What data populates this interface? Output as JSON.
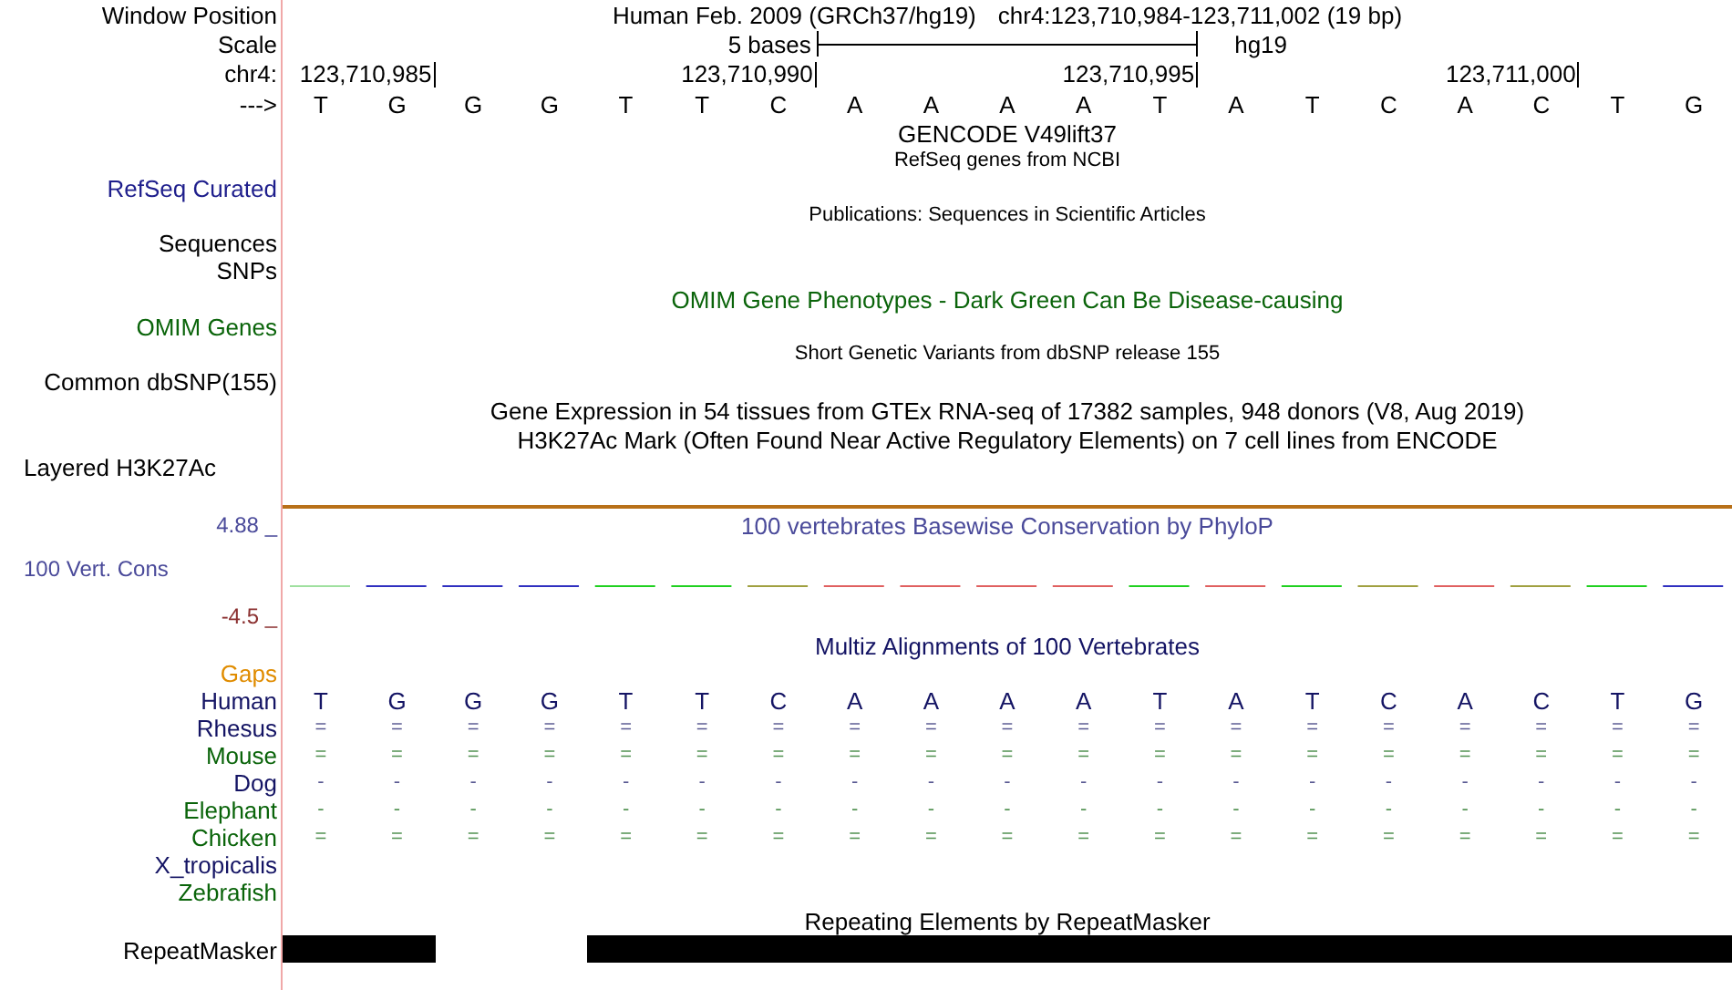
{
  "header": {
    "window_position_label": "Window Position",
    "assembly": "Human Feb. 2009 (GRCh37/hg19)",
    "position": "chr4:123,710,984-123,711,002 (19 bp)"
  },
  "scale": {
    "label": "Scale",
    "span": "5 bases",
    "db": "hg19"
  },
  "ruler": {
    "label": "chr4:",
    "ticks": [
      "123,710,985",
      "123,710,990",
      "123,710,995",
      "123,711,000"
    ]
  },
  "sequence": {
    "label": "--->",
    "bases": [
      "T",
      "G",
      "G",
      "G",
      "T",
      "T",
      "C",
      "A",
      "A",
      "A",
      "A",
      "T",
      "A",
      "T",
      "C",
      "A",
      "C",
      "T",
      "G"
    ]
  },
  "rows": [
    {
      "kind": "title",
      "text": "GENCODE V49lift37",
      "color": "#000000"
    },
    {
      "kind": "small_title",
      "text": "RefSeq genes from NCBI",
      "color": "#000000"
    },
    {
      "kind": "label",
      "text": "RefSeq Curated",
      "color": "#1e1e8c"
    },
    {
      "kind": "small_title",
      "text": "Publications: Sequences in Scientific Articles",
      "color": "#000000"
    },
    {
      "kind": "label",
      "text": "Sequences",
      "color": "#000000"
    },
    {
      "kind": "label",
      "text": "SNPs",
      "color": "#000000"
    },
    {
      "kind": "title",
      "text": "OMIM Gene Phenotypes - Dark Green Can Be Disease-causing",
      "color": "#0a640a"
    },
    {
      "kind": "label",
      "text": "OMIM Genes",
      "color": "#0a640a"
    },
    {
      "kind": "small_title",
      "text": "Short Genetic Variants from dbSNP release 155",
      "color": "#000000"
    },
    {
      "kind": "label",
      "text": "Common dbSNP(155)",
      "color": "#000000"
    },
    {
      "kind": "title",
      "text": "Gene Expression in 54 tissues from GTEx RNA-seq of 17382 samples, 948 donors (V8, Aug 2019)",
      "color": "#000000"
    },
    {
      "kind": "title",
      "text": "H3K27Ac Mark (Often Found Near Active Regulatory Elements) on 7 cell lines from ENCODE",
      "color": "#000000"
    },
    {
      "kind": "left_label",
      "text": "Layered H3K27Ac",
      "color": "#000000"
    },
    {
      "kind": "divider"
    },
    {
      "kind": "axis_top",
      "text": "4.88 _",
      "title": "100 vertebrates Basewise Conservation by PhyloP",
      "color": "#4a4a9a"
    },
    {
      "kind": "wiggle",
      "text": "100 Vert. Cons",
      "color": "#4a4a9a"
    },
    {
      "kind": "axis_bottom",
      "text": "-4.5 _",
      "color": "#8b3030"
    },
    {
      "kind": "title",
      "text": "Multiz Alignments of 100 Vertebrates",
      "color": "#141464"
    },
    {
      "kind": "label",
      "text": "Gaps",
      "color": "#e08c00"
    },
    {
      "kind": "alignment",
      "text": "Human",
      "color": "#141464",
      "symbols": [
        "T",
        "G",
        "G",
        "G",
        "T",
        "T",
        "C",
        "A",
        "A",
        "A",
        "A",
        "T",
        "A",
        "T",
        "C",
        "A",
        "C",
        "T",
        "G"
      ]
    },
    {
      "kind": "alignment",
      "text": "Rhesus",
      "color": "#141464",
      "symbols": [
        "=",
        "=",
        "=",
        "=",
        "=",
        "=",
        "=",
        "=",
        "=",
        "=",
        "=",
        "=",
        "=",
        "=",
        "=",
        "=",
        "=",
        "=",
        "="
      ]
    },
    {
      "kind": "alignment",
      "text": "Mouse",
      "color": "#0a640a",
      "symbols": [
        "=",
        "=",
        "=",
        "=",
        "=",
        "=",
        "=",
        "=",
        "=",
        "=",
        "=",
        "=",
        "=",
        "=",
        "=",
        "=",
        "=",
        "=",
        "="
      ]
    },
    {
      "kind": "alignment",
      "text": "Dog",
      "color": "#141464",
      "symbols": [
        "-",
        "-",
        "-",
        "-",
        "-",
        "-",
        "-",
        "-",
        "-",
        "-",
        "-",
        "-",
        "-",
        "-",
        "-",
        "-",
        "-",
        "-",
        "-"
      ]
    },
    {
      "kind": "alignment",
      "text": "Elephant",
      "color": "#0a640a",
      "symbols": [
        "-",
        "-",
        "-",
        "-",
        "-",
        "-",
        "-",
        "-",
        "-",
        "-",
        "-",
        "-",
        "-",
        "-",
        "-",
        "-",
        "-",
        "-",
        "-"
      ]
    },
    {
      "kind": "alignment",
      "text": "Chicken",
      "color": "#0a640a",
      "symbols": [
        "=",
        "=",
        "=",
        "=",
        "=",
        "=",
        "=",
        "=",
        "=",
        "=",
        "=",
        "=",
        "=",
        "=",
        "=",
        "=",
        "=",
        "=",
        "="
      ]
    },
    {
      "kind": "alignment",
      "text": "X_tropicalis",
      "color": "#141464",
      "symbols": []
    },
    {
      "kind": "alignment",
      "text": "Zebrafish",
      "color": "#0a640a",
      "symbols": []
    },
    {
      "kind": "title",
      "text": "Repeating Elements by RepeatMasker",
      "color": "#000000"
    },
    {
      "kind": "repeats",
      "text": "RepeatMasker",
      "color": "#000000",
      "masked": [
        true,
        true,
        false,
        false,
        true,
        true,
        true,
        true,
        true,
        true,
        true,
        true,
        true,
        true,
        true,
        true,
        true,
        true,
        true
      ]
    }
  ]
}
